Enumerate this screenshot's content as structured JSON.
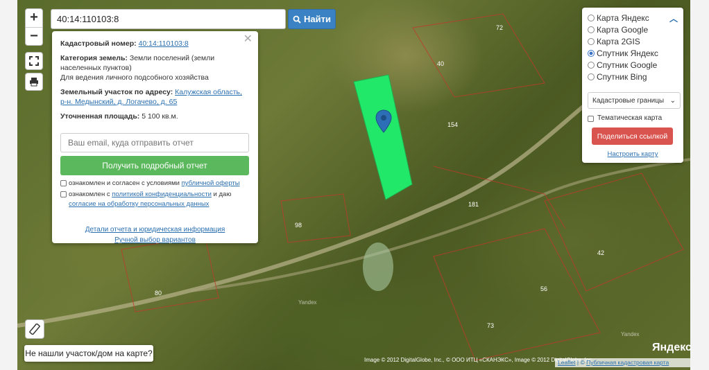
{
  "search": {
    "value": "40:14:110103:8",
    "button": "Найти"
  },
  "zoom": {
    "in": "+",
    "out": "−"
  },
  "popup": {
    "cadastral_label": "Кадастровый номер:",
    "cadastral_value": "40:14:110103:8",
    "category_label": "Категория земель:",
    "category_value": "Земли поселений (земли населенных пунктов)",
    "use_value": "Для ведения личного подсобного хозяйства",
    "address_label": "Земельный участок по адресу:",
    "address_value": "Калужская область, р-н. Медынский, д. Логачево, д. 65",
    "area_label": "Уточненная площадь:",
    "area_value": "5 100 кв.м.",
    "email_placeholder": "Ваш email, куда отправить отчет",
    "report_button": "Получить подробный отчет",
    "consent1_pre": "ознакомлен и согласен с условиями ",
    "consent1_link": "публичной оферты",
    "consent2_pre": "ознакомлен с ",
    "consent2_link1": "политикой конфиденциальности",
    "consent2_mid": " и даю ",
    "consent2_link2": "согласие на обработку персональных данных",
    "details_link": "Детали отчета и юридическая информация",
    "manual_link": "Ручной выбор вариантов"
  },
  "layers": {
    "options": [
      "Карта Яндекс",
      "Карта Google",
      "Карта 2GIS",
      "Спутник Яндекс",
      "Спутник Google",
      "Спутник Bing"
    ],
    "selected": "Спутник Яндекс",
    "select_value": "Кадастровые границы",
    "thematic_label": "Тематическая карта",
    "share_button": "Поделиться ссылкой",
    "tune_link": "Настроить карту"
  },
  "not_found_button": "Не нашли участок/дом на карте?",
  "attribution": {
    "imagery": "Image © 2012 DigitalGlobe, Inc., © ООО ИТЦ «СКАНЭКС», Image © 2012 DigitalGlobe, Inc.",
    "leaflet": "Leaflet",
    "source": "Публичная кадастровая карта",
    "yandex_logo": "Яндекс",
    "watermark": "Yandex"
  },
  "plot_numbers": [
    "72",
    "40",
    "154",
    "181",
    "42",
    "56",
    "73",
    "80",
    "98"
  ],
  "colors": {
    "parcel": "#22e86a",
    "marker": "#2d6fb6",
    "boundary": "#c0392b",
    "search_button": "#3b82c4",
    "report_button": "#5cb85c",
    "share_button": "#d9534f"
  }
}
